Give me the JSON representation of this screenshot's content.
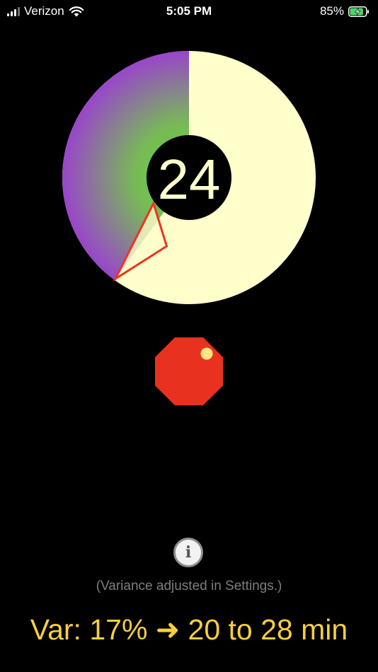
{
  "status_bar": {
    "carrier": "Verizon",
    "time": "5:05 PM",
    "battery_percent": "85%",
    "battery_level": 0.85,
    "charging": true
  },
  "dial": {
    "value": "24",
    "wedge_fraction": 0.1,
    "colors": {
      "face": "#ffffcc",
      "gradient_center": "#66cc44",
      "gradient_edge": "#9944cc",
      "pointer_outline": "#ee3322",
      "hub": "#000000",
      "value_text": "#ffffcc"
    }
  },
  "stop_button": {
    "icon": "stop-octagon-icon",
    "color": "#e8321f",
    "indicator_color": "#ffe680"
  },
  "info": {
    "icon": "info-icon",
    "glyph": "i"
  },
  "note": "(Variance adjusted in Settings.)",
  "summary": {
    "text": "Var: 17% ➜ 20 to 28 min",
    "color": "#f7cf3e"
  }
}
